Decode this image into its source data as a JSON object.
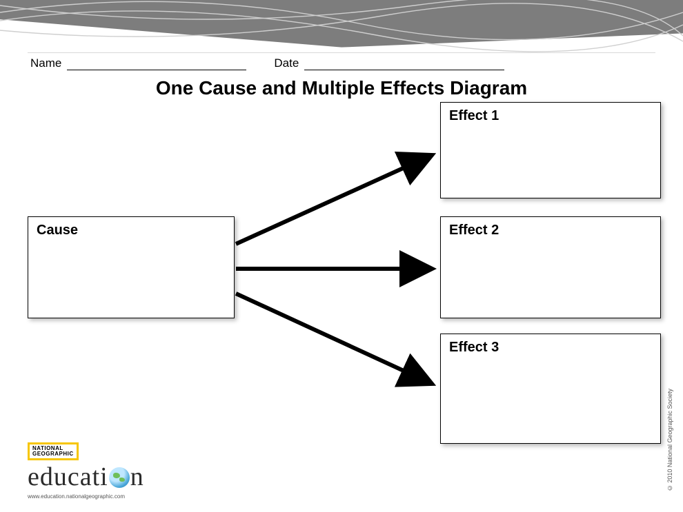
{
  "header": {
    "name_label": "Name",
    "date_label": "Date"
  },
  "title": "One Cause and Multiple Effects Diagram",
  "boxes": {
    "cause": "Cause",
    "effect1": "Effect 1",
    "effect2": "Effect 2",
    "effect3": "Effect 3"
  },
  "footer": {
    "brand_top": "NATIONAL",
    "brand_bottom": "GEOGRAPHIC",
    "edu_prefix": "educati",
    "edu_suffix": "n",
    "website": "www.education.nationalgeographic.com",
    "copyright": "© 2010 National Geographic Society"
  },
  "chart_data": {
    "type": "diagram",
    "structure": "one-to-many",
    "source": "Cause",
    "targets": [
      "Effect 1",
      "Effect 2",
      "Effect 3"
    ],
    "title": "One Cause and Multiple Effects Diagram"
  }
}
